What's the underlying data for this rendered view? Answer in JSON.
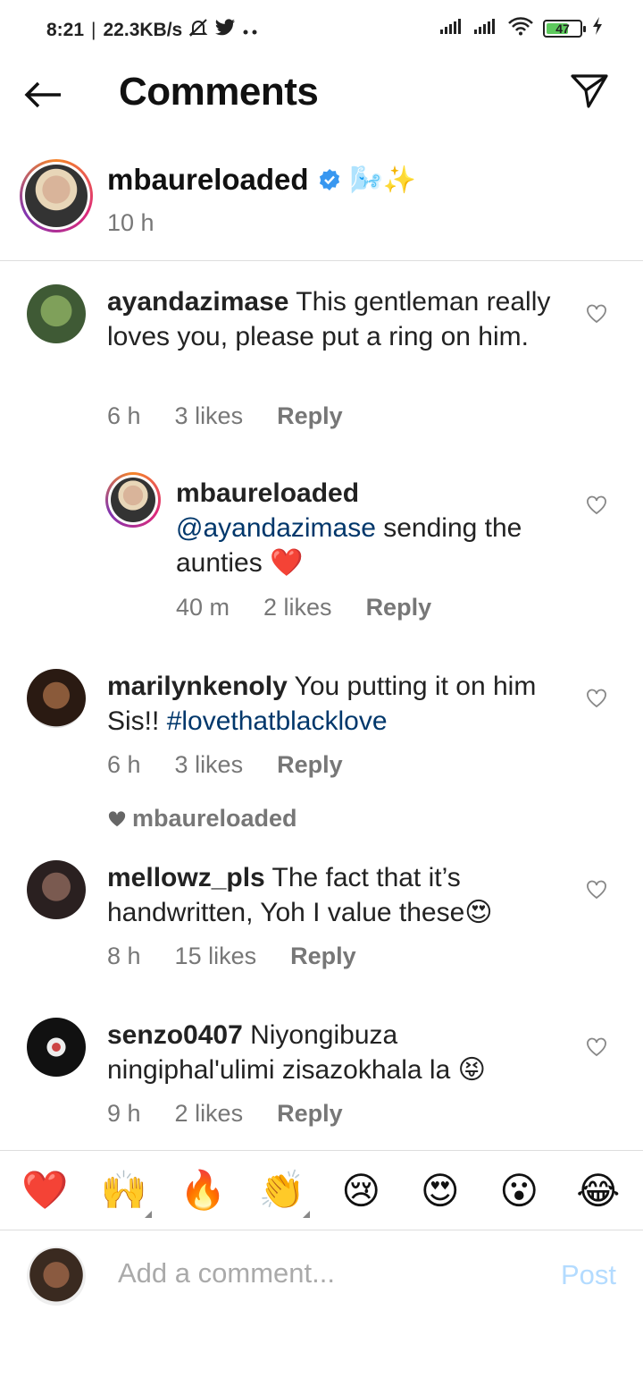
{
  "status_bar": {
    "time": "8:21",
    "network_speed": "22.3KB/s",
    "battery": "47",
    "icons": [
      "mute-bell-icon",
      "twitter-icon",
      "more-dots-icon",
      "signal-icon",
      "signal-icon",
      "wifi-icon",
      "battery-icon",
      "charging-icon"
    ]
  },
  "header": {
    "title": "Comments",
    "back_icon": "back-arrow-icon",
    "send_icon": "direct-send-icon"
  },
  "post": {
    "username": "mbaureloaded",
    "verified": true,
    "emojis": "🌬️✨",
    "time": "10 h"
  },
  "comments": [
    {
      "username": "ayandazimase",
      "text": " This gentleman really loves you, please put a ring on him.",
      "time": "6 h",
      "likes": "3 likes",
      "reply": "Reply",
      "avatar_color": "#5a7a4a"
    },
    {
      "username": "mbaureloaded",
      "mention": "@ayandazimase",
      "text": " sending the aunties ❤️",
      "time": "40 m",
      "likes": "2 likes",
      "reply": "Reply",
      "avatar_color": "#c9a48a"
    },
    {
      "username": "marilynkenoly",
      "text": " You putting it on him Sis!! ",
      "hashtag": "#lovethatblacklove",
      "time": "6 h",
      "likes": "3 likes",
      "reply": "Reply",
      "liked_by": "mbaureloaded",
      "avatar_color": "#6b4a30"
    },
    {
      "username": "mellowz_pls",
      "text": " The fact that it’s handwritten, Yoh I value these😍",
      "time": "8 h",
      "likes": "15 likes",
      "reply": "Reply",
      "avatar_color": "#3a3030"
    },
    {
      "username": "senzo0407",
      "text": " Niyongibuza ningiphal'ulimi zisazokhala la 😝",
      "time": "9 h",
      "likes": "2 likes",
      "reply": "Reply",
      "avatar_color": "#1a1a2a"
    }
  ],
  "emoji_bar": [
    "❤️",
    "🙌",
    "🔥",
    "👏",
    "😢",
    "😍",
    "😮",
    "😂"
  ],
  "compose": {
    "placeholder": "Add a comment...",
    "post_label": "Post"
  },
  "colors": {
    "link": "#00376b",
    "meta": "#777777",
    "post_button": "#b3dbff",
    "verified": "#3897f0"
  }
}
